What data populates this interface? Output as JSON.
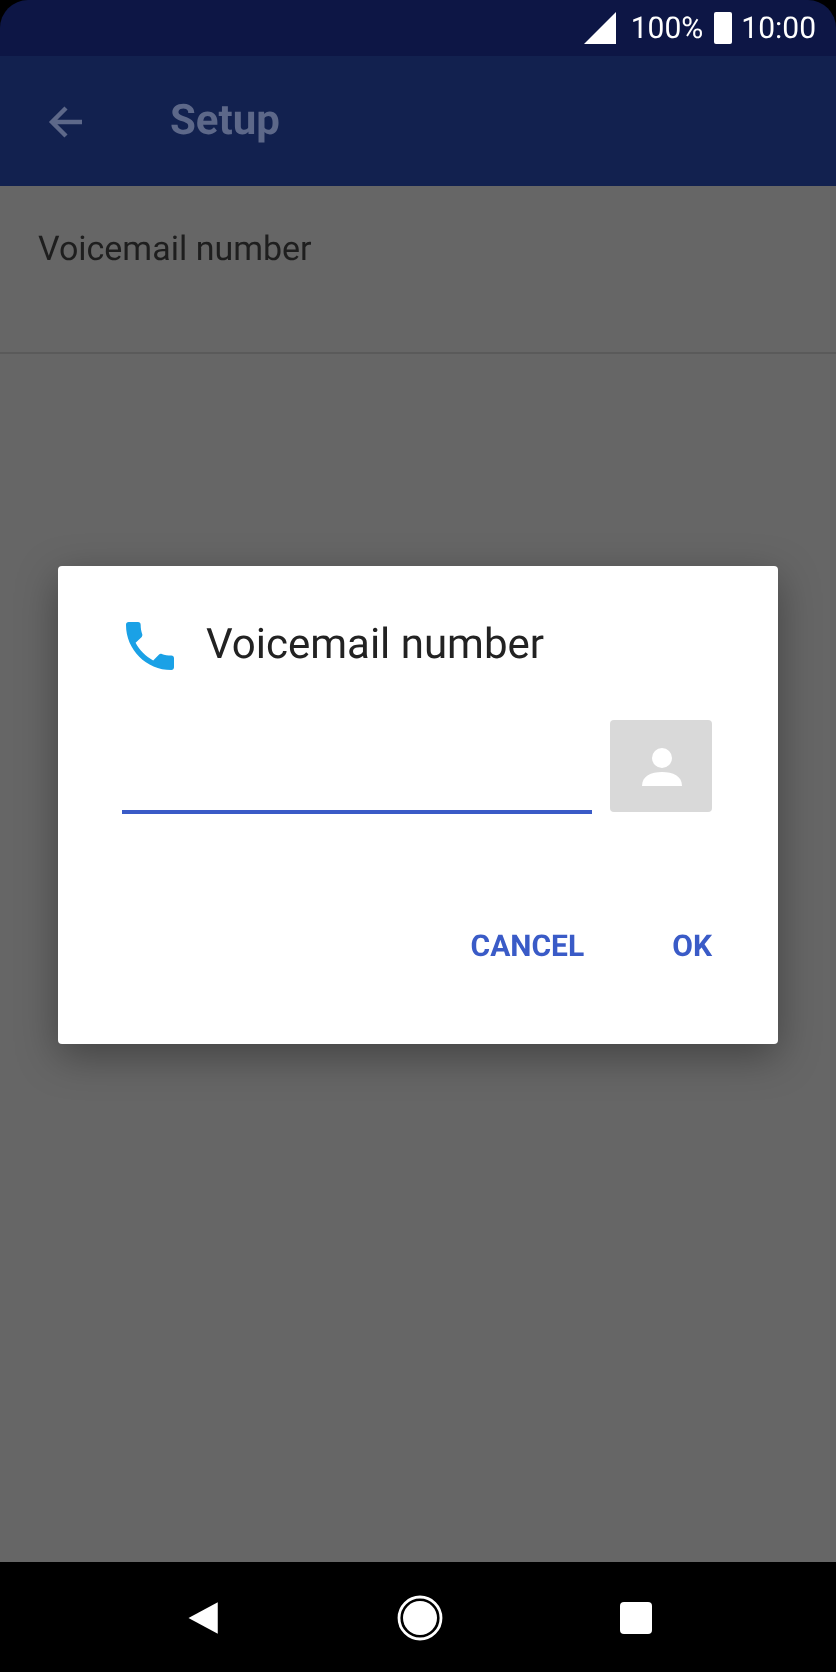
{
  "status_bar": {
    "battery": "100%",
    "time": "10:00"
  },
  "app_bar": {
    "title": "Setup"
  },
  "settings": [
    {
      "label": "Voicemail number"
    }
  ],
  "dialog": {
    "title": "Voicemail number",
    "input": {
      "focused": true
    },
    "buttons": [
      {
        "label": "CANCEL"
      },
      {
        "label": "OK"
      }
    ]
  }
}
